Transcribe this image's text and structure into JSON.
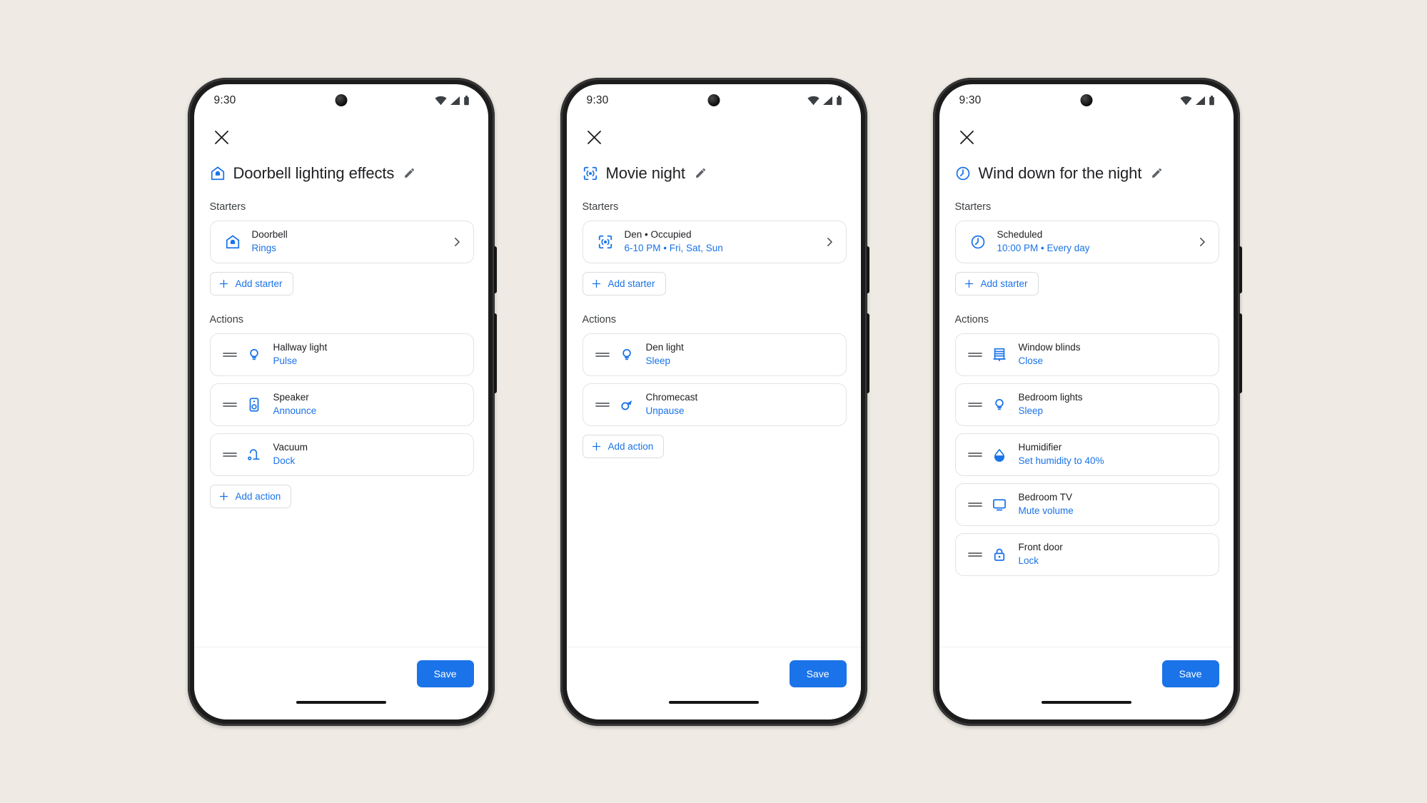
{
  "background_color": "#efeae4",
  "accent_color": "#1a73e8",
  "phones": [
    {
      "status": {
        "time": "9:30",
        "wifi_icon": "wifi-icon",
        "signal_icon": "cellular-signal-icon",
        "battery_icon": "battery-icon"
      },
      "close_label": "close-icon",
      "title": "Doorbell lighting effects",
      "title_icon": "doorbell-home-icon",
      "edit_icon": "pencil-edit-icon",
      "starters_label": "Starters",
      "actions_label": "Actions",
      "starters": [
        {
          "icon": "doorbell-home-icon",
          "title": "Doorbell",
          "sub": "Rings",
          "chevron": "chevron-right-icon"
        }
      ],
      "add_starter_label": "Add starter",
      "actions": [
        {
          "icon": "lightbulb-icon",
          "title": "Hallway light",
          "sub": "Pulse"
        },
        {
          "icon": "speaker-icon",
          "title": "Speaker",
          "sub": "Announce"
        },
        {
          "icon": "vacuum-icon",
          "title": "Vacuum",
          "sub": "Dock"
        }
      ],
      "add_action_label": "Add action",
      "save_label": "Save"
    },
    {
      "status": {
        "time": "9:30",
        "wifi_icon": "wifi-icon",
        "signal_icon": "cellular-signal-icon",
        "battery_icon": "battery-icon"
      },
      "close_label": "close-icon",
      "title": "Movie night",
      "title_icon": "motion-sensor-icon",
      "edit_icon": "pencil-edit-icon",
      "starters_label": "Starters",
      "actions_label": "Actions",
      "starters": [
        {
          "icon": "motion-sensor-icon",
          "title": "Den • Occupied",
          "sub": "6-10 PM • Fri, Sat, Sun",
          "chevron": "chevron-right-icon"
        }
      ],
      "add_starter_label": "Add starter",
      "actions": [
        {
          "icon": "lightbulb-icon",
          "title": "Den light",
          "sub": "Sleep"
        },
        {
          "icon": "chromecast-icon",
          "title": "Chromecast",
          "sub": "Unpause"
        }
      ],
      "add_action_label": "Add action",
      "save_label": "Save"
    },
    {
      "status": {
        "time": "9:30",
        "wifi_icon": "wifi-icon",
        "signal_icon": "cellular-signal-icon",
        "battery_icon": "battery-icon"
      },
      "close_label": "close-icon",
      "title": "Wind down for the night",
      "title_icon": "clock-icon",
      "edit_icon": "pencil-edit-icon",
      "starters_label": "Starters",
      "actions_label": "Actions",
      "starters": [
        {
          "icon": "clock-icon",
          "title": "Scheduled",
          "sub": "10:00 PM • Every day",
          "chevron": "chevron-right-icon"
        }
      ],
      "add_starter_label": "Add starter",
      "actions": [
        {
          "icon": "window-blinds-icon",
          "title": "Window blinds",
          "sub": "Close"
        },
        {
          "icon": "lightbulb-icon",
          "title": "Bedroom lights",
          "sub": "Sleep"
        },
        {
          "icon": "humidity-drop-icon",
          "title": "Humidifier",
          "sub": "Set humidity to 40%"
        },
        {
          "icon": "tv-icon",
          "title": "Bedroom TV",
          "sub": "Mute volume"
        },
        {
          "icon": "lock-icon",
          "title": "Front door",
          "sub": "Lock"
        }
      ],
      "save_label": "Save"
    }
  ]
}
